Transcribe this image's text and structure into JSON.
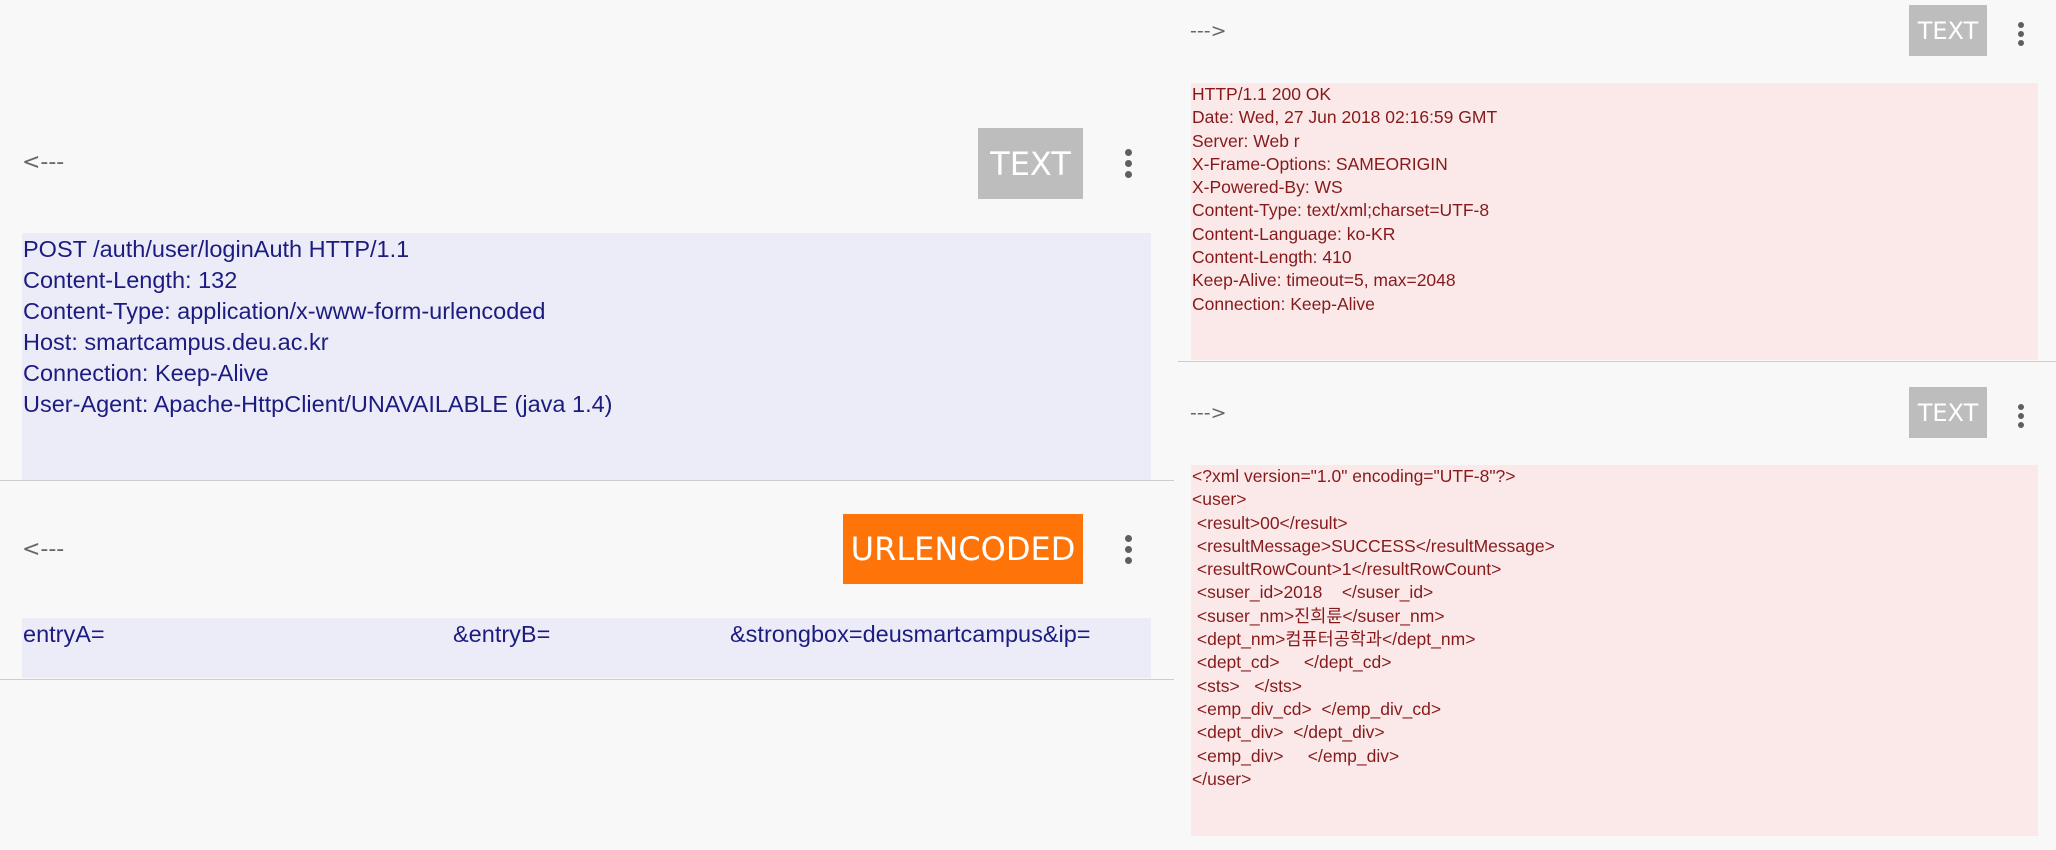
{
  "request_headers": {
    "arrow": "<---",
    "badge": "TEXT",
    "badge_color": "#bdbdbd",
    "lines": [
      "POST /auth/user/loginAuth HTTP/1.1",
      "Content-Length: 132",
      "Content-Type: application/x-www-form-urlencoded",
      "Host: smartcampus.deu.ac.kr",
      "Connection: Keep-Alive",
      "User-Agent: Apache-HttpClient/UNAVAILABLE (java 1.4)"
    ]
  },
  "request_body": {
    "arrow": "<---",
    "badge": "URLENCODED",
    "badge_color": "#ff7409",
    "segments": [
      "entryA=",
      "&entryB=",
      "&strongbox=deusmartcampus&ip="
    ]
  },
  "response_headers": {
    "arrow": "--->",
    "badge": "TEXT",
    "lines": [
      "HTTP/1.1 200 OK",
      "Date: Wed, 27 Jun 2018 02:16:59 GMT",
      "Server: Web r",
      "X-Frame-Options: SAMEORIGIN",
      "X-Powered-By: WS",
      "Content-Type: text/xml;charset=UTF-8",
      "Content-Language: ko-KR",
      "Content-Length: 410",
      "Keep-Alive: timeout=5, max=2048",
      "Connection: Keep-Alive"
    ]
  },
  "response_body": {
    "arrow": "--->",
    "badge": "TEXT",
    "lines": [
      "<?xml version=\"1.0\" encoding=\"UTF-8\"?>",
      "<user>",
      " <result>00</result>",
      " <resultMessage>SUCCESS</resultMessage>",
      " <resultRowCount>1</resultRowCount>",
      " <suser_id>2018    </suser_id>",
      " <suser_nm>진희륜</suser_nm>",
      " <dept_nm>컴퓨터공학과</dept_nm>",
      " <dept_cd>     </dept_cd>",
      " <sts>   </sts>",
      " <emp_div_cd>  </emp_div_cd>",
      " <dept_div>  </dept_div>",
      " <emp_div>     </emp_div>",
      "</user>"
    ]
  }
}
